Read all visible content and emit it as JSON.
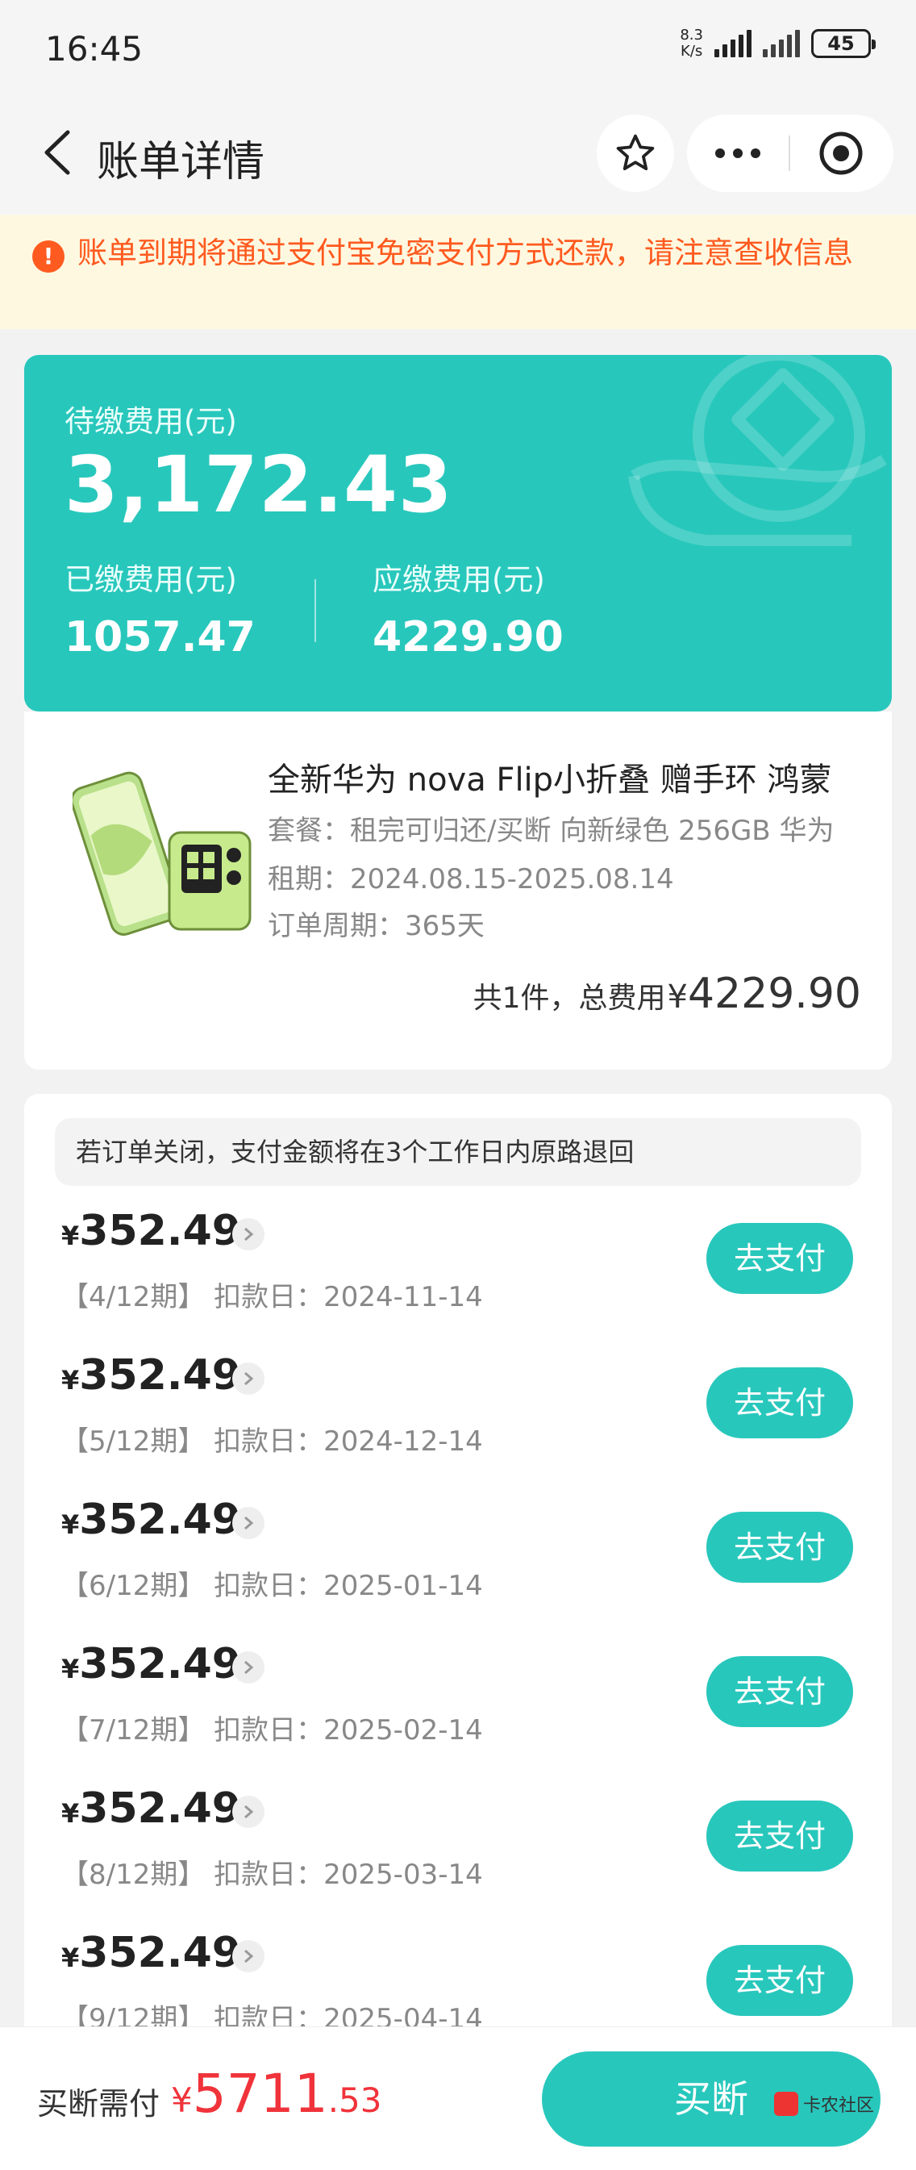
{
  "status_bar": {
    "time": "16:45",
    "speed_top": "8.3",
    "speed_bottom": "K/s",
    "battery": "45"
  },
  "nav": {
    "title": "账单详情"
  },
  "notice": {
    "text": "账单到期将通过支付宝免密支付方式还款，请注意查收信息"
  },
  "summary": {
    "pending_label": "待缴费用(元)",
    "pending_amount": "3,172.43",
    "paid_label": "已缴费用(元)",
    "paid_amount": "1057.47",
    "due_label": "应缴费用(元)",
    "due_amount": "4229.90"
  },
  "product": {
    "title": "全新华为 nova Flip小折叠 赠手环 鸿蒙",
    "package": "套餐：租完可归还/买断 向新绿色 256GB 华为",
    "period": "租期：2024.08.15-2025.08.14",
    "cycle": "订单周期：365天",
    "total_prefix": "共1件，总费用",
    "total_currency": "¥",
    "total_amount": "4229.90"
  },
  "installments": {
    "tip": "若订单关闭，支付金额将在3个工作日内原路退回",
    "currency": "¥",
    "pay_label": "去支付",
    "items": [
      {
        "amount": "352.49",
        "meta": "【4/12期】 扣款日：2024-11-14"
      },
      {
        "amount": "352.49",
        "meta": "【5/12期】 扣款日：2024-12-14"
      },
      {
        "amount": "352.49",
        "meta": "【6/12期】 扣款日：2025-01-14"
      },
      {
        "amount": "352.49",
        "meta": "【7/12期】 扣款日：2025-02-14"
      },
      {
        "amount": "352.49",
        "meta": "【8/12期】 扣款日：2025-03-14"
      },
      {
        "amount": "352.49",
        "meta": "【9/12期】 扣款日：2025-04-14"
      }
    ]
  },
  "bottom": {
    "label": "买断需付",
    "currency": "¥",
    "price_int": "5711",
    "price_dec": ".53",
    "button": "买断"
  },
  "watermark": "卡农社区",
  "colors": {
    "accent": "#28c7bc",
    "warning": "#ff5a1f",
    "price": "#f0333a"
  },
  "icons": [
    "back-arrow-icon",
    "star-icon",
    "more-dots-icon",
    "close-target-icon",
    "warning-icon",
    "chevron-right-icon"
  ]
}
